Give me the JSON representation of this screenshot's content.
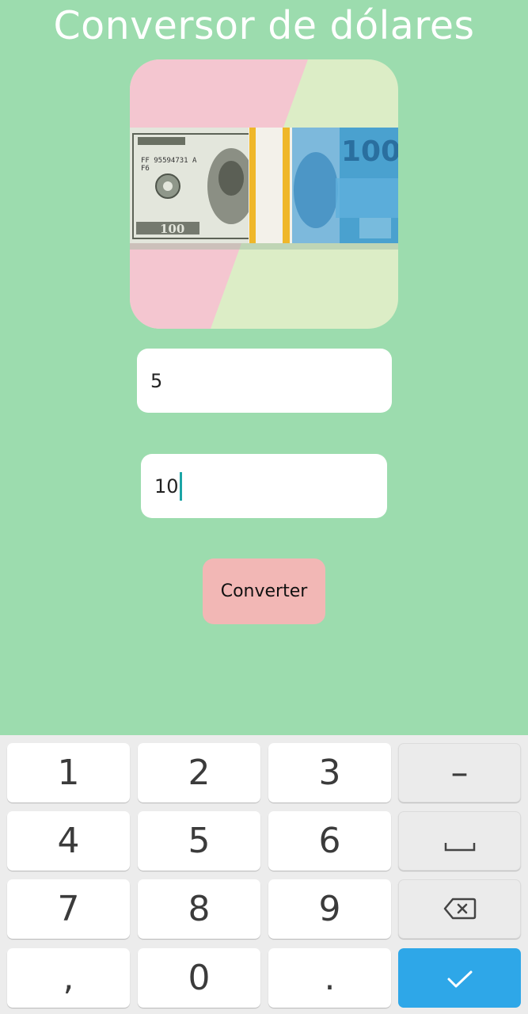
{
  "app": {
    "title": "Conversor de dólares"
  },
  "hero": {
    "banknote_value_right": "100"
  },
  "form": {
    "amount_value": "5",
    "rate_value": "10",
    "convert_label": "Converter"
  },
  "keyboard": {
    "keys": {
      "k1": "1",
      "k2": "2",
      "k3": "3",
      "minus": "–",
      "k4": "4",
      "k5": "5",
      "k6": "6",
      "k7": "7",
      "k8": "8",
      "k9": "9",
      "comma": ",",
      "k0": "0",
      "period": "."
    },
    "icons": {
      "space": "space-icon",
      "backspace": "backspace-icon",
      "done": "check-icon"
    },
    "accent_color": "#2ea7e8"
  },
  "colors": {
    "background": "#9cdcae",
    "button": "#f2b7b5",
    "caret": "#1ca5a6"
  }
}
